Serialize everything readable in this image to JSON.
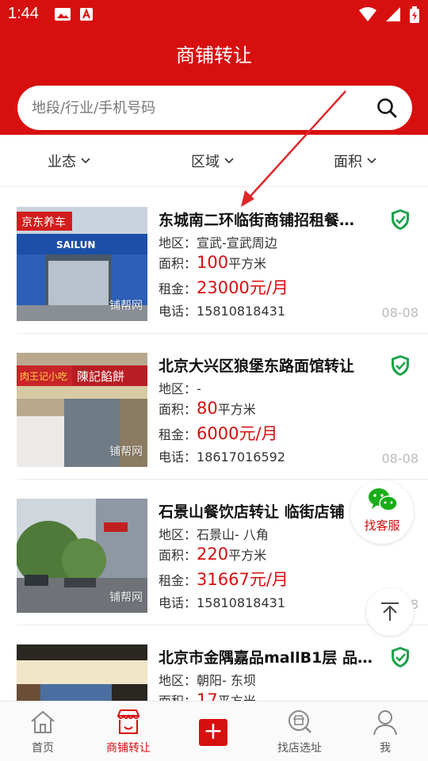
{
  "status": {
    "time": "1:44"
  },
  "header": {
    "title": "商铺转让"
  },
  "search": {
    "placeholder": "地段/行业/手机号码"
  },
  "filters": [
    {
      "label": "业态"
    },
    {
      "label": "区域"
    },
    {
      "label": "面积"
    }
  ],
  "labels": {
    "district": "地区：",
    "area": "面积：",
    "rent": "租金：",
    "phone": "电话：",
    "area_unit": "平方米"
  },
  "listings": [
    {
      "title": "东城南二环临街商铺招租餐…",
      "district": "宣武-宣武周边",
      "area": "100",
      "rent": "23000元/月",
      "phone": "15810818431",
      "date": "08-08",
      "watermark": "铺帮网"
    },
    {
      "title": "北京大兴区狼堡东路面馆转让",
      "district": "-",
      "area": "80",
      "rent": "6000元/月",
      "phone": "18617016592",
      "date": "08-08",
      "watermark": "铺帮网"
    },
    {
      "title": "石景山餐饮店转让 临街店铺",
      "district": "石景山- 八角",
      "area": "220",
      "rent": "31667元/月",
      "phone": "15810818431",
      "date": "08-08",
      "watermark": "铺帮网"
    },
    {
      "title": "北京市金隅嘉品mallB1层 品…",
      "district": "朝阳- 东坝",
      "area": "17",
      "rent": "",
      "phone": "",
      "date": "",
      "watermark": ""
    }
  ],
  "floating": {
    "service_label": "找客服"
  },
  "tabbar": {
    "items": [
      {
        "label": "首页",
        "icon": "home-icon"
      },
      {
        "label": "商铺转让",
        "icon": "shop-icon",
        "active": true
      },
      {
        "label": "",
        "icon": "plus-icon"
      },
      {
        "label": "找店选址",
        "icon": "search-shop-icon"
      },
      {
        "label": "我",
        "icon": "user-icon"
      }
    ]
  },
  "colors": {
    "brand": "#d70f0f",
    "verify": "#1aa34a"
  }
}
